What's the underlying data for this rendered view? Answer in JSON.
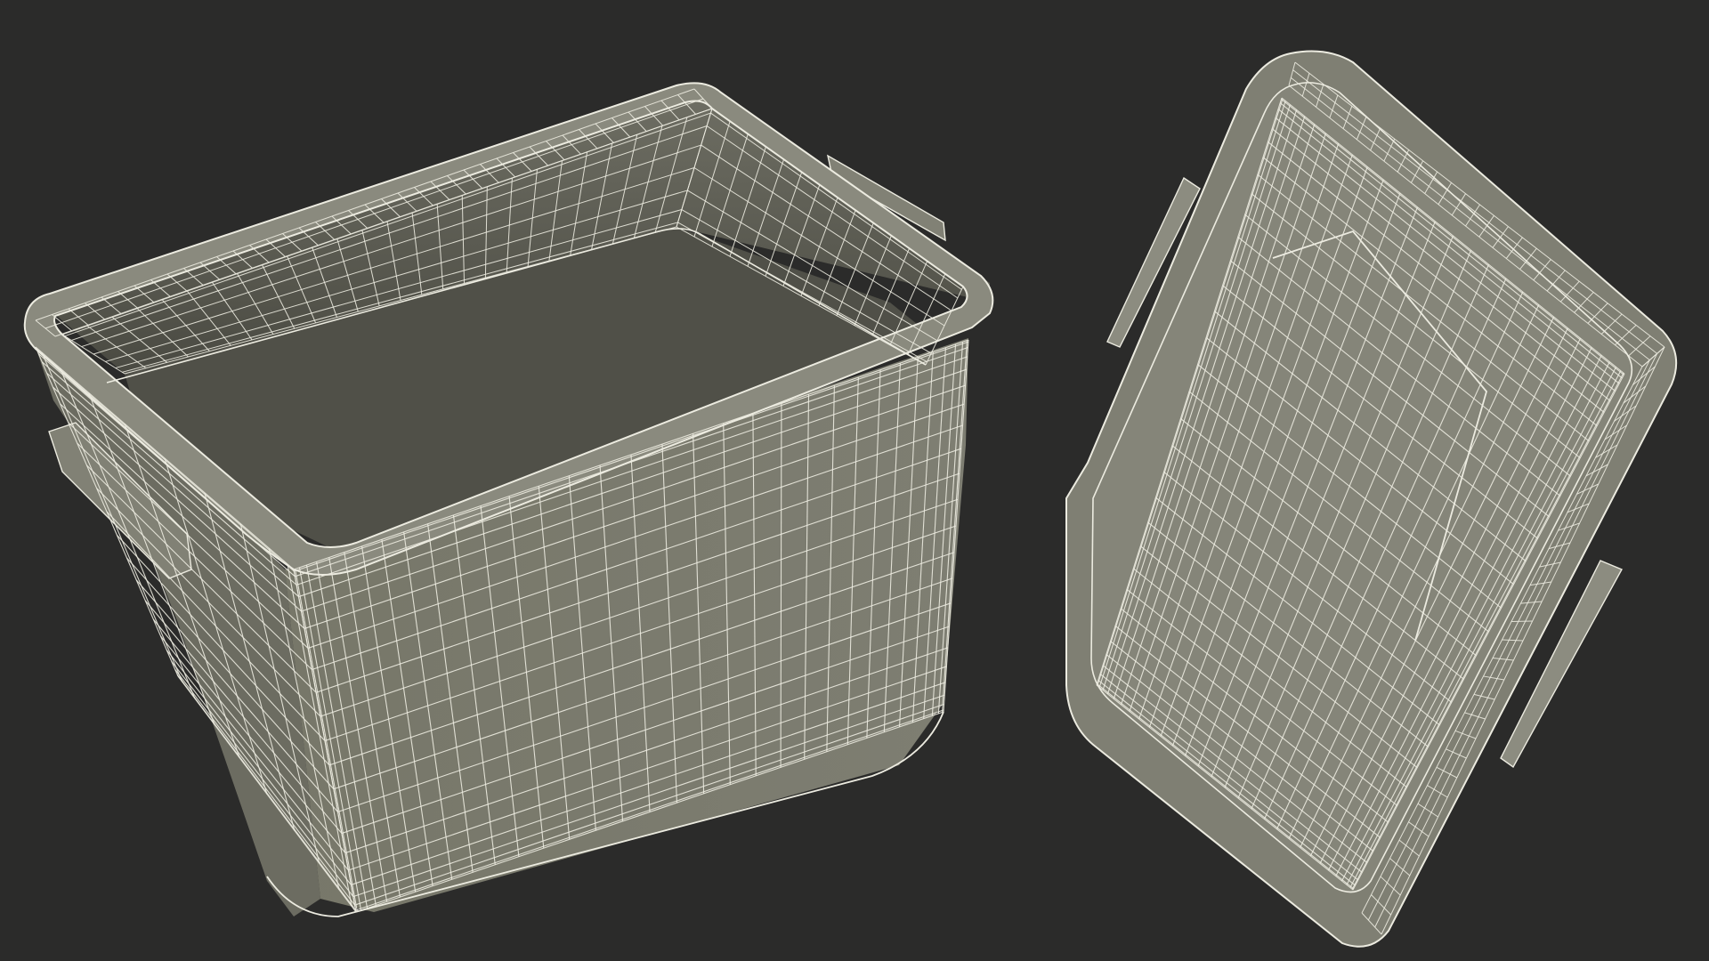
{
  "scene": {
    "background_color": "#2b2b2a",
    "surface_color": "#7c7c70",
    "surface_light": "#8e8e82",
    "surface_dark": "#55554c",
    "wire_color": "#ecebe0",
    "objects": [
      {
        "name": "storage-bin-body",
        "kind": "open container, wireframe render"
      },
      {
        "name": "storage-bin-lid",
        "kind": "lid, wireframe render"
      }
    ]
  }
}
